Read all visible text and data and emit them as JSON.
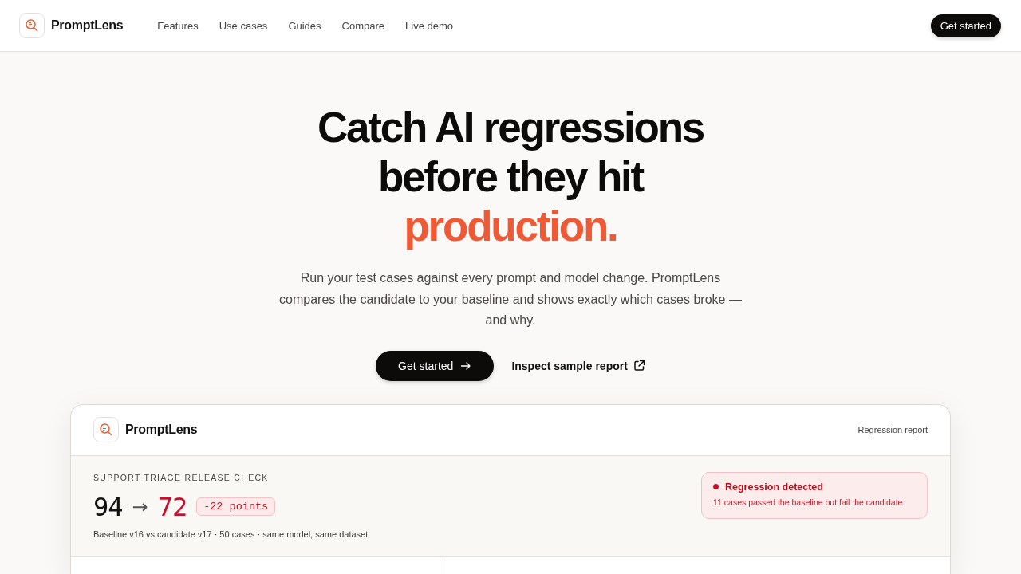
{
  "nav": {
    "brand": "PromptLens",
    "links": [
      "Features",
      "Use cases",
      "Guides",
      "Compare",
      "Live demo"
    ],
    "cta": "Get started"
  },
  "hero": {
    "title_lines": [
      {
        "text": "Catch AI regressions",
        "accent": false
      },
      {
        "text": "before they hit",
        "accent": false
      },
      {
        "text": "production.",
        "accent": true
      }
    ],
    "subtitle": "Run your test cases against every prompt and model change. PromptLens compares the candidate to your baseline and shows exactly which cases broke — and why.",
    "primary_button": "Get started",
    "secondary_link": "Inspect sample report"
  },
  "report": {
    "brand": "PromptLens",
    "label": "Regression report",
    "eyebrow": "SUPPORT TRIAGE RELEASE CHECK",
    "baseline_score": "94",
    "arrow": "→",
    "candidate_score": "72",
    "delta": "-22 points",
    "meta": "Baseline v16 vs candidate v17 · 50 cases · same model, same dataset",
    "alert": {
      "title": "Regression detected",
      "message": "11 cases passed the baseline but fail the candidate."
    }
  }
}
